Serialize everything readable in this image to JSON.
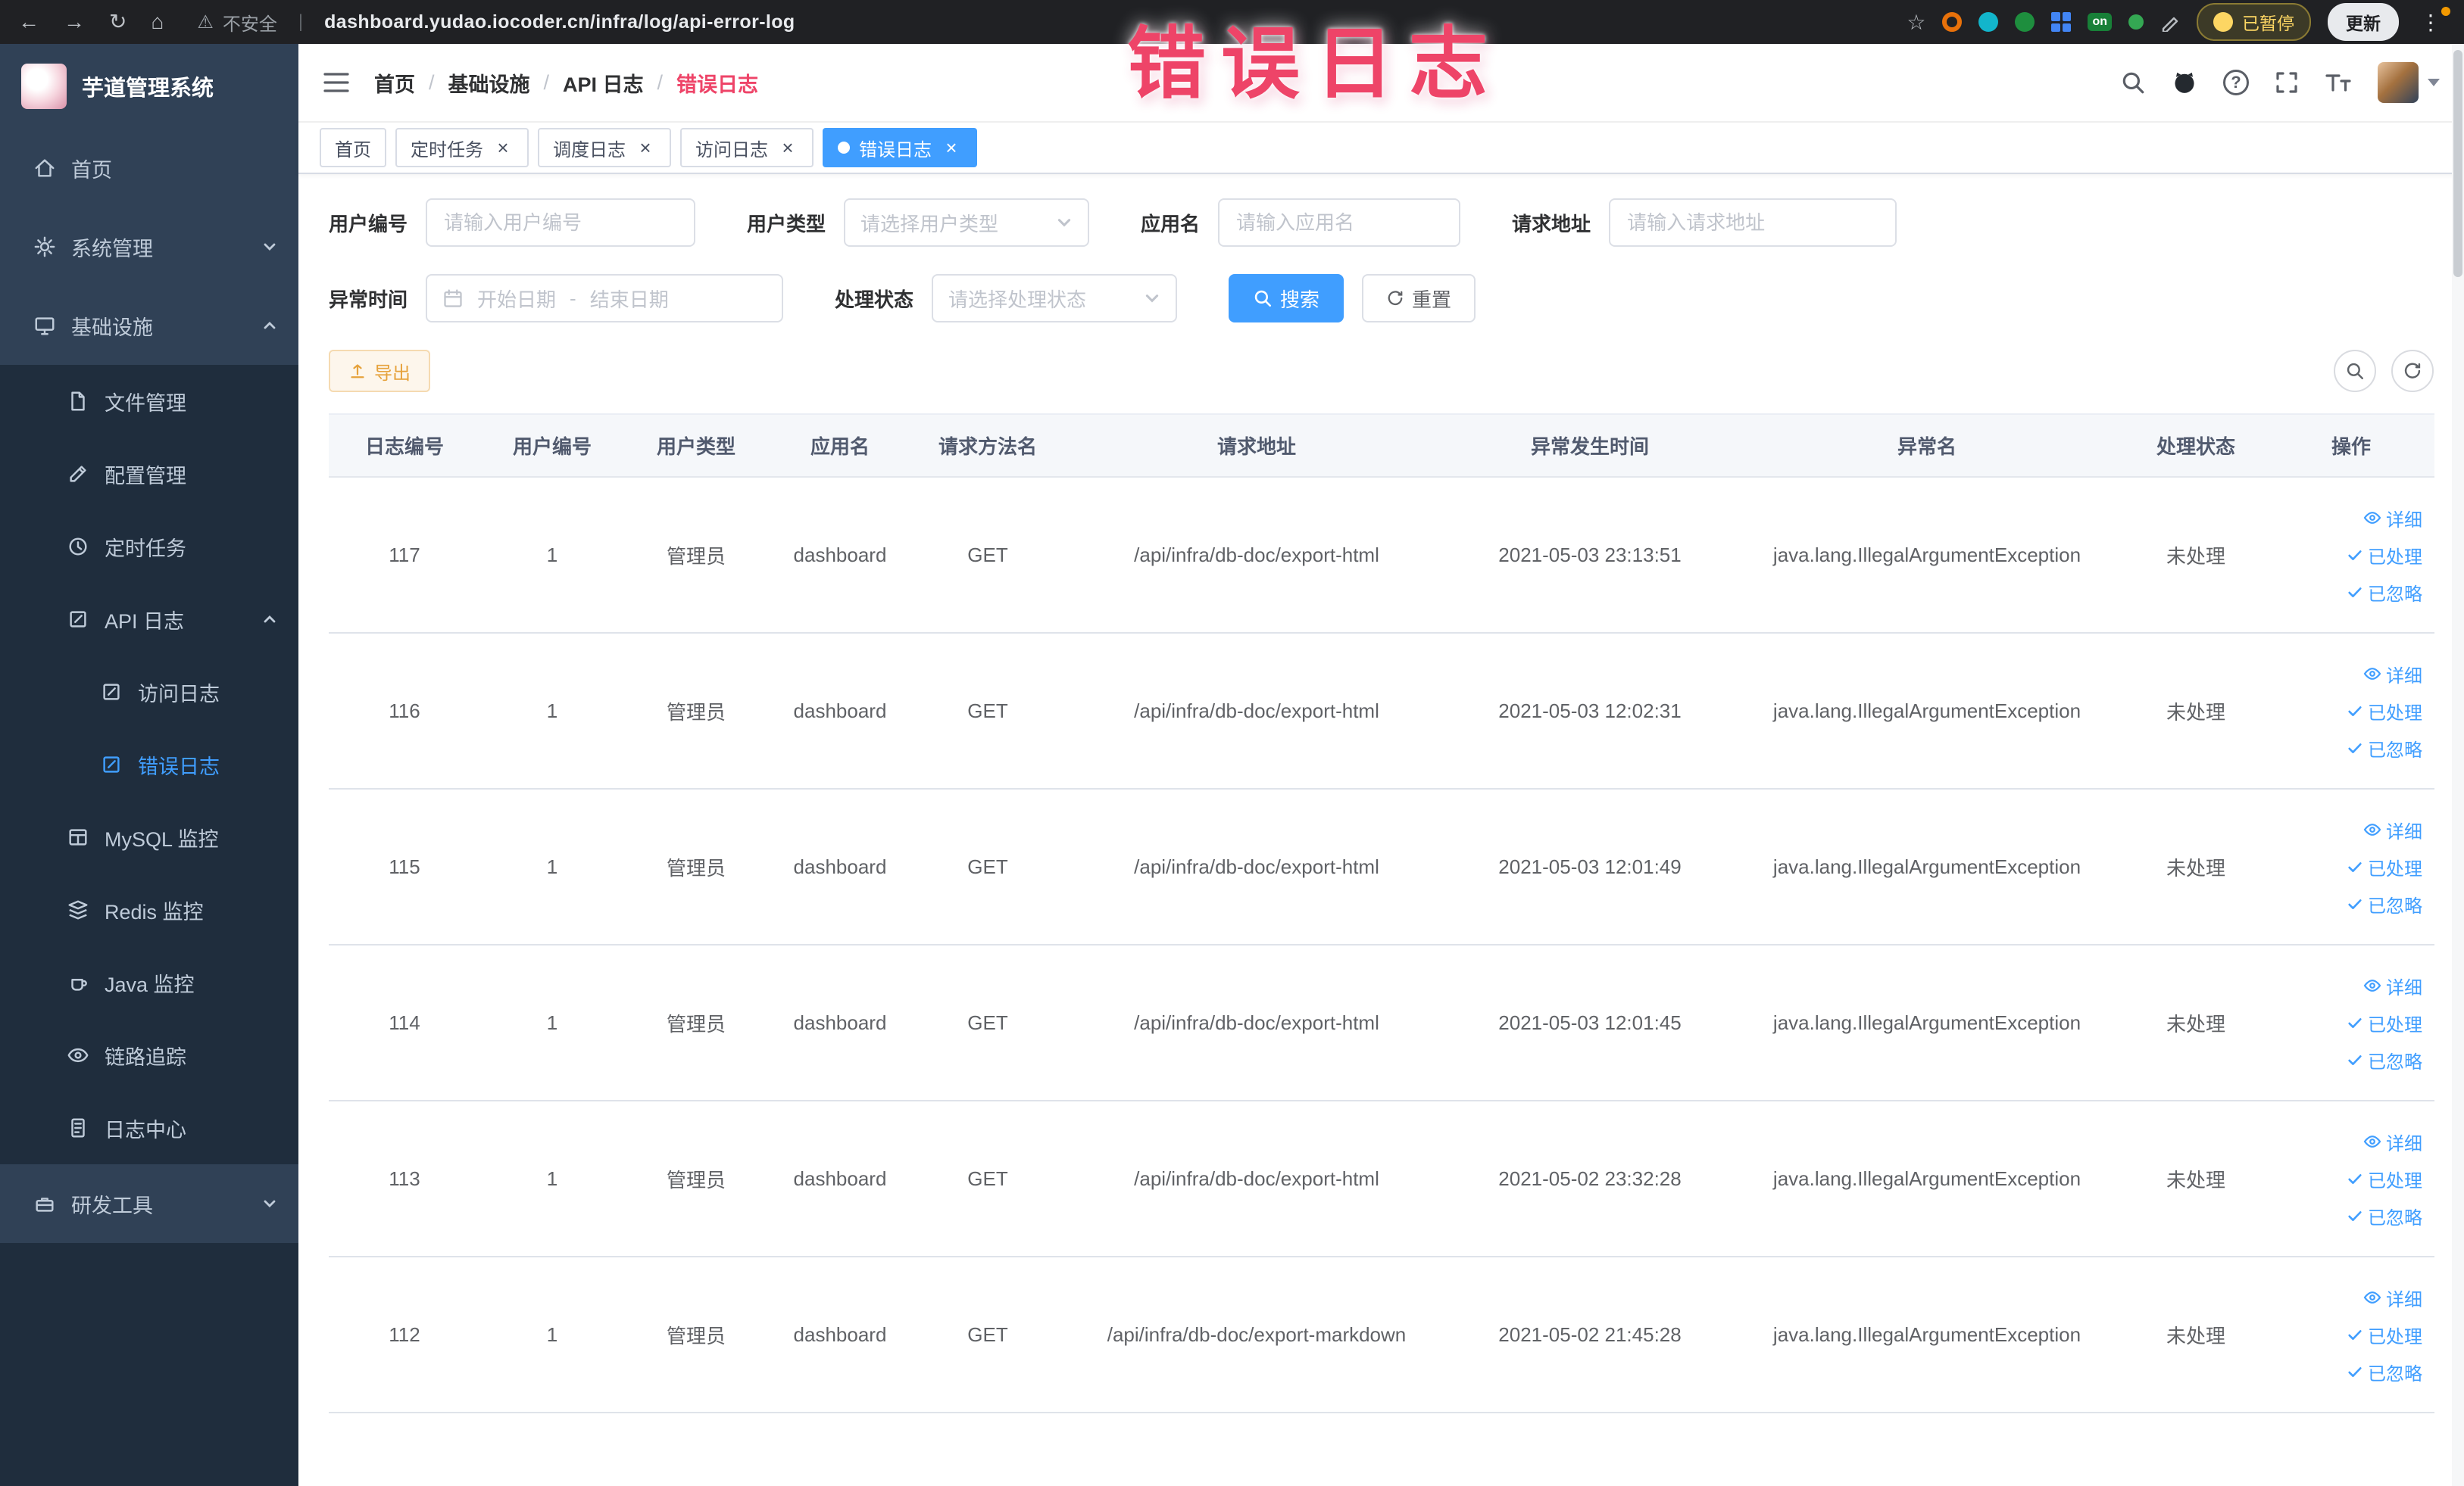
{
  "browser": {
    "security_label": "不安全",
    "url": "dashboard.yudao.iocoder.cn/infra/log/api-error-log",
    "paused_badge": "已暂停",
    "update_button": "更新",
    "on_badge": "on"
  },
  "icons": {
    "back": "←",
    "forward": "→",
    "reload": "↻",
    "home": "⌂",
    "warning": "⚠",
    "star": "☆",
    "url_divider": "|",
    "menu_dots": "⋮",
    "help": "?",
    "close": "×",
    "breadcrumb_separator": "/",
    "range_separator": "-"
  },
  "watermark": "错误日志",
  "sidebar": {
    "logo_title": "芋道管理系统",
    "items": [
      {
        "label": "首页",
        "icon": "home-icon"
      },
      {
        "label": "系统管理",
        "icon": "gear-icon",
        "state": "collapsed"
      },
      {
        "label": "基础设施",
        "icon": "infrastructure-icon",
        "state": "expanded",
        "children": [
          {
            "label": "文件管理",
            "icon": "file-icon"
          },
          {
            "label": "配置管理",
            "icon": "config-icon"
          },
          {
            "label": "定时任务",
            "icon": "schedule-icon"
          },
          {
            "label": "API 日志",
            "icon": "api-log-icon",
            "state": "expanded",
            "children": [
              {
                "label": "访问日志",
                "icon": "access-log-icon",
                "active": false
              },
              {
                "label": "错误日志",
                "icon": "error-log-icon",
                "active": true
              }
            ]
          },
          {
            "label": "MySQL 监控",
            "icon": "mysql-icon"
          },
          {
            "label": "Redis 监控",
            "icon": "redis-icon"
          },
          {
            "label": "Java 监控",
            "icon": "java-icon"
          },
          {
            "label": "链路追踪",
            "icon": "trace-icon"
          },
          {
            "label": "日志中心",
            "icon": "log-center-icon"
          }
        ]
      },
      {
        "label": "研发工具",
        "icon": "tools-icon",
        "state": "collapsed"
      }
    ]
  },
  "topbar": {
    "breadcrumb": [
      "首页",
      "基础设施",
      "API 日志",
      "错误日志"
    ]
  },
  "tabs": [
    {
      "label": "首页",
      "closable": false,
      "active": false
    },
    {
      "label": "定时任务",
      "closable": true,
      "active": false
    },
    {
      "label": "调度日志",
      "closable": true,
      "active": false
    },
    {
      "label": "访问日志",
      "closable": true,
      "active": false
    },
    {
      "label": "错误日志",
      "closable": true,
      "active": true
    }
  ],
  "filters": {
    "user_id": {
      "label": "用户编号",
      "placeholder": "请输入用户编号"
    },
    "user_type": {
      "label": "用户类型",
      "placeholder": "请选择用户类型"
    },
    "app_name": {
      "label": "应用名",
      "placeholder": "请输入应用名"
    },
    "request_url": {
      "label": "请求地址",
      "placeholder": "请输入请求地址"
    },
    "exception_time": {
      "label": "异常时间",
      "start_placeholder": "开始日期",
      "end_placeholder": "结束日期"
    },
    "process_status": {
      "label": "处理状态",
      "placeholder": "请选择处理状态"
    },
    "search_button": "搜索",
    "reset_button": "重置"
  },
  "toolbar": {
    "export_button": "导出"
  },
  "table": {
    "headers": [
      "日志编号",
      "用户编号",
      "用户类型",
      "应用名",
      "请求方法名",
      "请求地址",
      "异常发生时间",
      "异常名",
      "处理状态",
      "操作"
    ],
    "actions": {
      "detail": "详细",
      "processed": "已处理",
      "ignored": "已忽略"
    },
    "rows": [
      {
        "id": "117",
        "user_id": "1",
        "user_type": "管理员",
        "app": "dashboard",
        "method": "GET",
        "url": "/api/infra/db-doc/export-html",
        "time": "2021-05-03 23:13:51",
        "exception": "java.lang.IllegalArgumentException",
        "status": "未处理"
      },
      {
        "id": "116",
        "user_id": "1",
        "user_type": "管理员",
        "app": "dashboard",
        "method": "GET",
        "url": "/api/infra/db-doc/export-html",
        "time": "2021-05-03 12:02:31",
        "exception": "java.lang.IllegalArgumentException",
        "status": "未处理"
      },
      {
        "id": "115",
        "user_id": "1",
        "user_type": "管理员",
        "app": "dashboard",
        "method": "GET",
        "url": "/api/infra/db-doc/export-html",
        "time": "2021-05-03 12:01:49",
        "exception": "java.lang.IllegalArgumentException",
        "status": "未处理"
      },
      {
        "id": "114",
        "user_id": "1",
        "user_type": "管理员",
        "app": "dashboard",
        "method": "GET",
        "url": "/api/infra/db-doc/export-html",
        "time": "2021-05-03 12:01:45",
        "exception": "java.lang.IllegalArgumentException",
        "status": "未处理"
      },
      {
        "id": "113",
        "user_id": "1",
        "user_type": "管理员",
        "app": "dashboard",
        "method": "GET",
        "url": "/api/infra/db-doc/export-html",
        "time": "2021-05-02 23:32:28",
        "exception": "java.lang.IllegalArgumentException",
        "status": "未处理"
      },
      {
        "id": "112",
        "user_id": "1",
        "user_type": "管理员",
        "app": "dashboard",
        "method": "GET",
        "url": "/api/infra/db-doc/export-markdown",
        "time": "2021-05-02 21:45:28",
        "exception": "java.lang.IllegalArgumentException",
        "status": "未处理"
      }
    ]
  }
}
